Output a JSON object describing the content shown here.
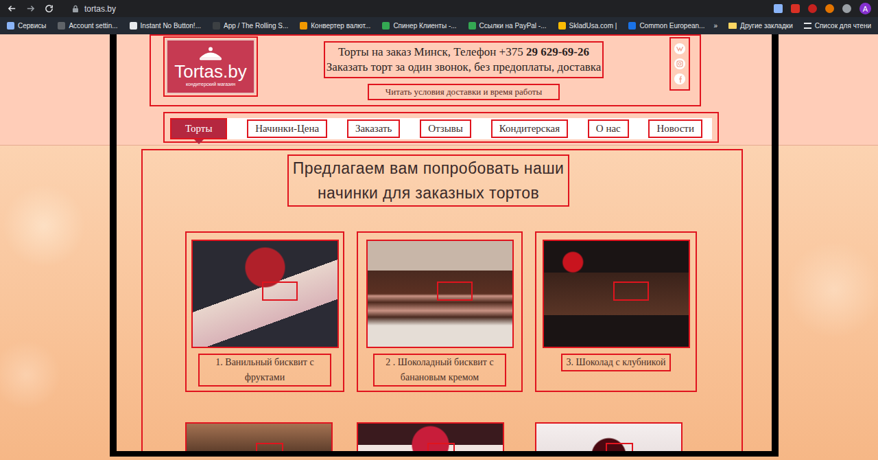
{
  "browser": {
    "url": "tortas.by",
    "profile_initial": "A",
    "bookmarks": [
      {
        "label": "Сервисы",
        "color": "#8ab4f8"
      },
      {
        "label": "Account settin...",
        "color": "#5f6368"
      },
      {
        "label": "Instant No Button!...",
        "color": "#e8eaed"
      },
      {
        "label": "App / The Rolling S...",
        "color": "#3c4043"
      },
      {
        "label": "Конвертер валют...",
        "color": "#f29900"
      },
      {
        "label": "Спинер Клиенты -...",
        "color": "#34a853"
      },
      {
        "label": "Ссылки на PayPal -...",
        "color": "#34a853"
      },
      {
        "label": "SkladUsa.com |",
        "color": "#fbbc04"
      },
      {
        "label": "Common European...",
        "color": "#1a73e8"
      }
    ],
    "overflow": "»",
    "other_bookmarks": "Другие закладки",
    "reading_list": "Список для чтени"
  },
  "site": {
    "logo": {
      "name": "Tortas.by",
      "tagline": "кондитерский магазин"
    },
    "header": {
      "title": "Торты на заказ Минск, Телефон",
      "phone_code": "+375",
      "phone": "29 629-69-26",
      "subtitle": "Заказать торт за один звонок, без предоплаты, доставка",
      "link": "Читать условия доставки и время работы"
    },
    "nav": [
      {
        "label": "Торты",
        "selected": true
      },
      {
        "label": "Начинки-Цена",
        "selected": false
      },
      {
        "label": "Заказать",
        "selected": false
      },
      {
        "label": "Отзывы",
        "selected": false
      },
      {
        "label": "Кондитерская",
        "selected": false
      },
      {
        "label": "О нас",
        "selected": false
      },
      {
        "label": "Новости",
        "selected": false
      }
    ],
    "heading": [
      "Предлагаем вам попробовать наши",
      "начинки для заказных тортов"
    ],
    "fillings": [
      {
        "kind": "full",
        "caption": "1. Ванильный бисквит с фруктами"
      },
      {
        "kind": "full",
        "caption": "2 . Шоколадный бисквит с банановым кремом"
      },
      {
        "kind": "full",
        "caption": "3. Шоколад с клубникой"
      },
      {
        "kind": "cut",
        "caption": ""
      },
      {
        "kind": "cut",
        "caption": ""
      },
      {
        "kind": "cut",
        "caption": ""
      }
    ]
  }
}
